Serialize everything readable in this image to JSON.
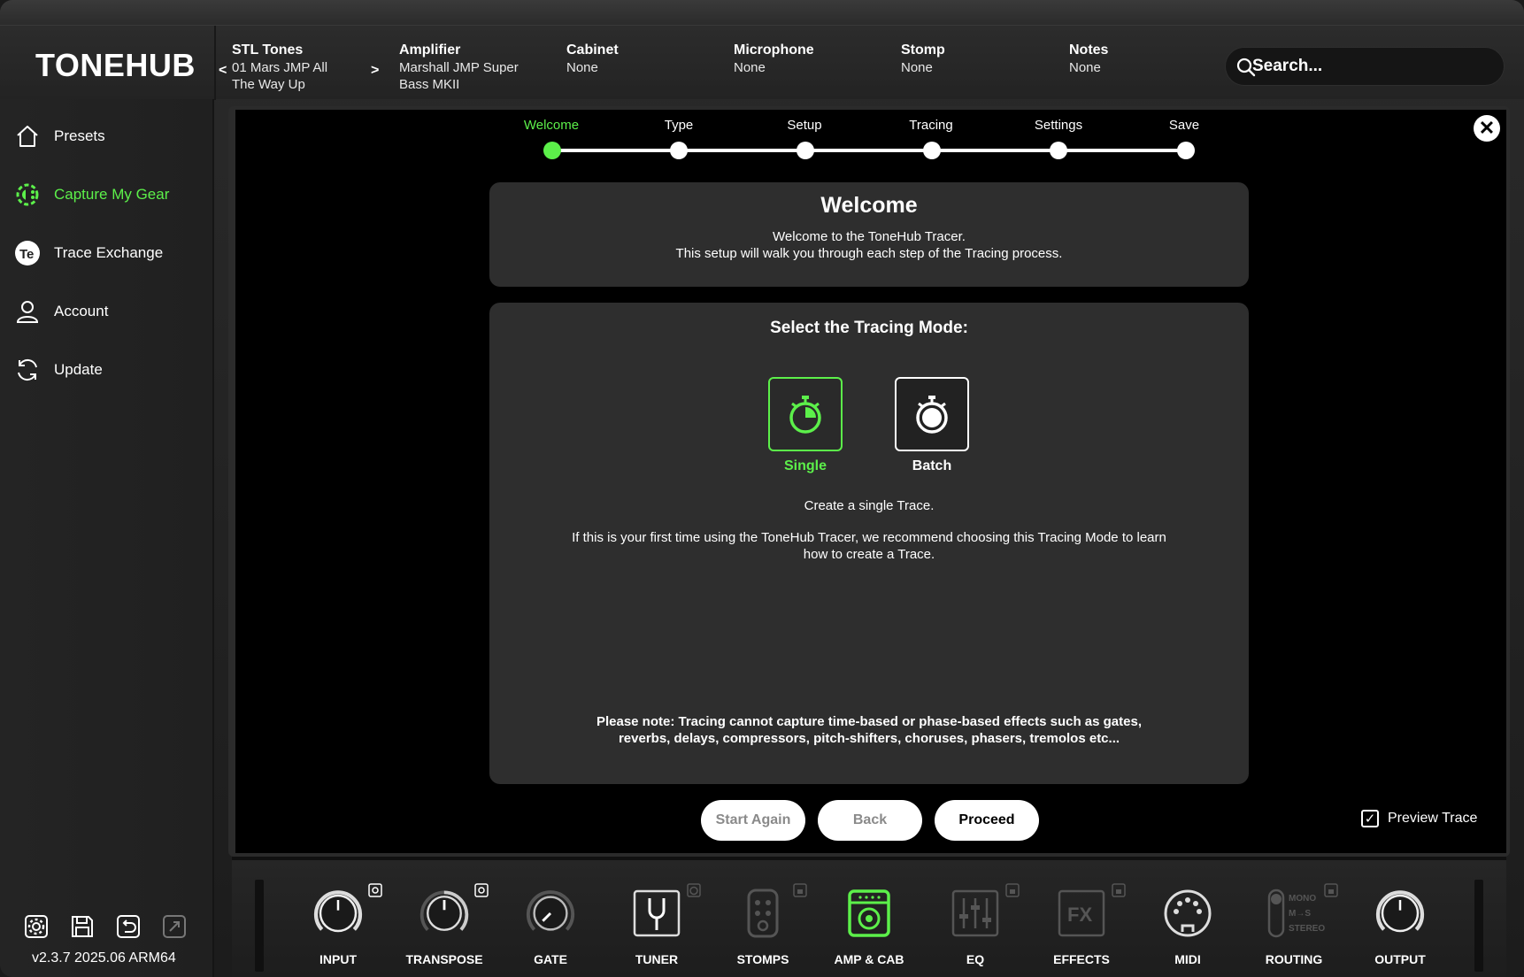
{
  "app": {
    "logo": "TONEHUB"
  },
  "header": {
    "columns": [
      {
        "title": "STL Tones",
        "value_line1": "01 Mars JMP All",
        "value_line2": "The Way Up"
      },
      {
        "title": "Amplifier",
        "value_line1": "Marshall JMP Super",
        "value_line2": "Bass MKII"
      },
      {
        "title": "Cabinet",
        "value_line1": "None",
        "value_line2": ""
      },
      {
        "title": "Microphone",
        "value_line1": "None",
        "value_line2": ""
      },
      {
        "title": "Stomp",
        "value_line1": "None",
        "value_line2": ""
      },
      {
        "title": "Notes",
        "value_line1": "None",
        "value_line2": ""
      }
    ],
    "prev_arrow": "<",
    "next_arrow": ">",
    "search_placeholder": "Search..."
  },
  "sidebar": {
    "items": [
      {
        "label": "Presets",
        "icon": "home-icon",
        "active": false
      },
      {
        "label": "Capture My Gear",
        "icon": "capture-gear-icon",
        "active": true
      },
      {
        "label": "Trace Exchange",
        "icon": "trace-exchange-icon",
        "active": false
      },
      {
        "label": "Account",
        "icon": "user-icon",
        "active": false
      },
      {
        "label": "Update",
        "icon": "refresh-icon",
        "active": false
      }
    ],
    "footer_icons": [
      "settings-icon",
      "save-icon",
      "undo-icon",
      "redo-icon"
    ],
    "version": "v2.3.7 2025.06 ARM64"
  },
  "stepper": {
    "steps": [
      "Welcome",
      "Type",
      "Setup",
      "Tracing",
      "Settings",
      "Save"
    ],
    "active_index": 0
  },
  "welcome_card": {
    "title": "Welcome",
    "line1": "Welcome to the ToneHub Tracer.",
    "line2": "This setup will walk you through each step of the Tracing process."
  },
  "mode_card": {
    "title": "Select the Tracing Mode:",
    "modes": [
      {
        "label": "Single",
        "icon": "stopwatch-icon",
        "selected": true
      },
      {
        "label": "Batch",
        "icon": "stopwatch-icon",
        "selected": false
      }
    ],
    "description": "Create a single Trace.",
    "recommendation_line1": "If this is your first time using the ToneHub Tracer, we recommend choosing this Tracing Mode to learn",
    "recommendation_line2": "how to create a Trace.",
    "note_line1": "Please note: Tracing cannot capture time-based or phase-based effects such as gates,",
    "note_line2": "reverbs, delays, compressors, pitch-shifters, choruses, phasers, tremolos etc..."
  },
  "buttons": {
    "start_again": "Start Again",
    "back": "Back",
    "proceed": "Proceed"
  },
  "preview_trace": {
    "label": "Preview Trace",
    "checked": true
  },
  "modules": [
    {
      "label": "INPUT",
      "icon": "knob-icon"
    },
    {
      "label": "TRANSPOSE",
      "icon": "knob-icon"
    },
    {
      "label": "GATE",
      "icon": "knob-icon"
    },
    {
      "label": "TUNER",
      "icon": "tuning-fork-icon"
    },
    {
      "label": "STOMPS",
      "icon": "pedal-icon"
    },
    {
      "label": "AMP & CAB",
      "icon": "amp-icon"
    },
    {
      "label": "EQ",
      "icon": "eq-sliders-icon"
    },
    {
      "label": "EFFECTS",
      "icon": "fx-icon"
    },
    {
      "label": "MIDI",
      "icon": "midi-icon"
    },
    {
      "label": "ROUTING",
      "icon": "routing-switch-icon",
      "options": [
        "MONO",
        "M→S",
        "STEREO"
      ]
    },
    {
      "label": "OUTPUT",
      "icon": "knob-icon"
    }
  ],
  "colors": {
    "accent": "#5cf04a",
    "background": "#000000",
    "card": "#2e2e2e"
  }
}
